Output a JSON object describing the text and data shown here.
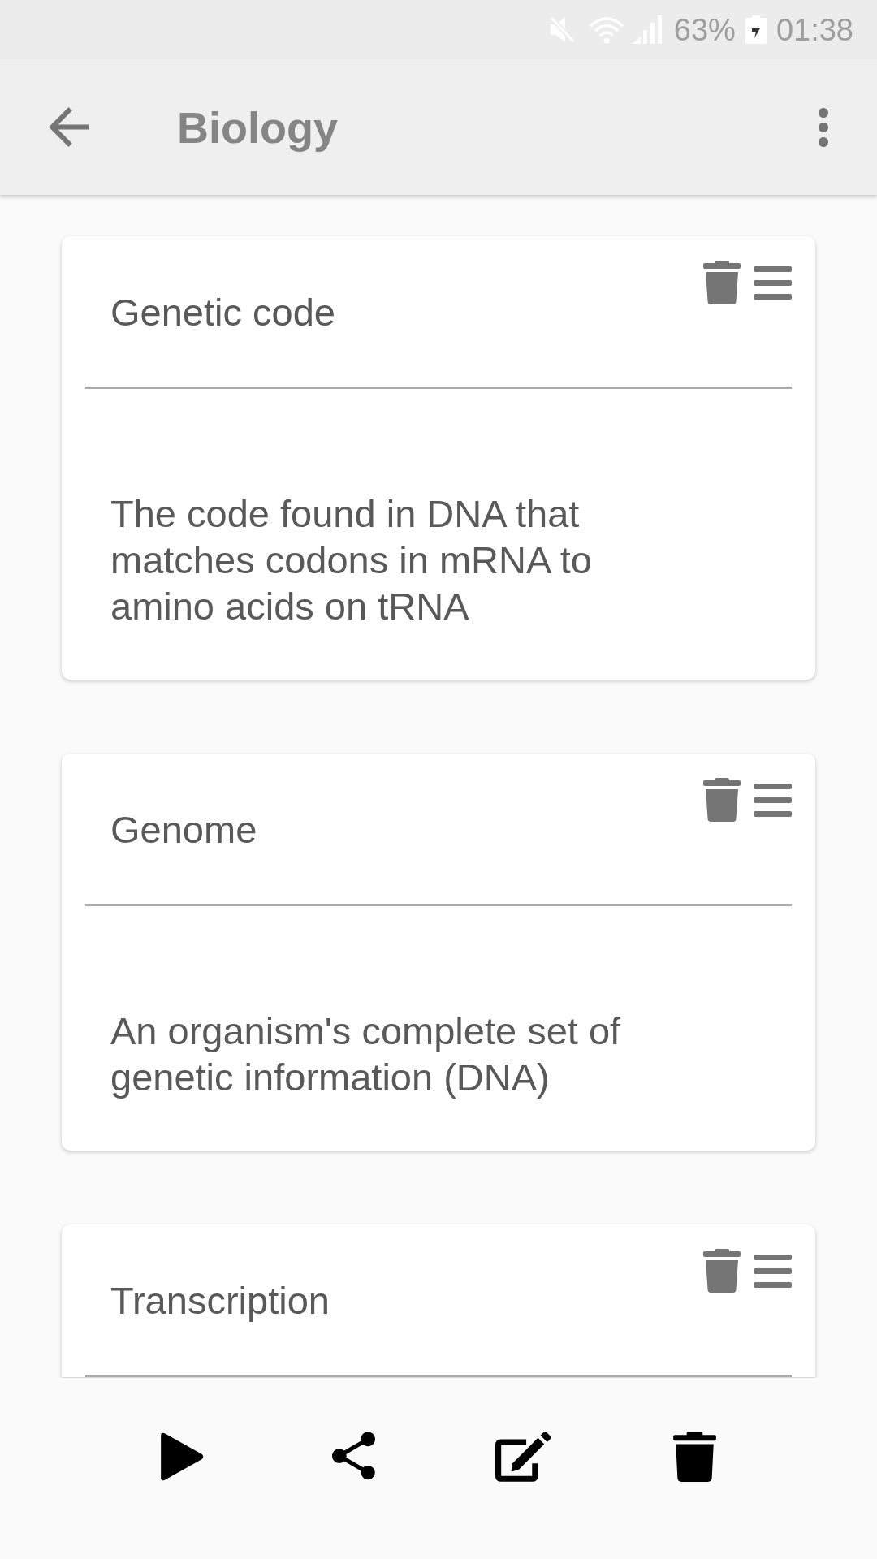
{
  "status_bar": {
    "battery": "63%",
    "time": "01:38"
  },
  "app_bar": {
    "title": "Biology"
  },
  "cards": [
    {
      "title": "Genetic code",
      "definition": "The code found in DNA that matches codons in mRNA to amino acids on tRNA"
    },
    {
      "title": "Genome",
      "definition": "An organism's complete set of genetic information (DNA)"
    },
    {
      "title": "Transcription"
    }
  ]
}
